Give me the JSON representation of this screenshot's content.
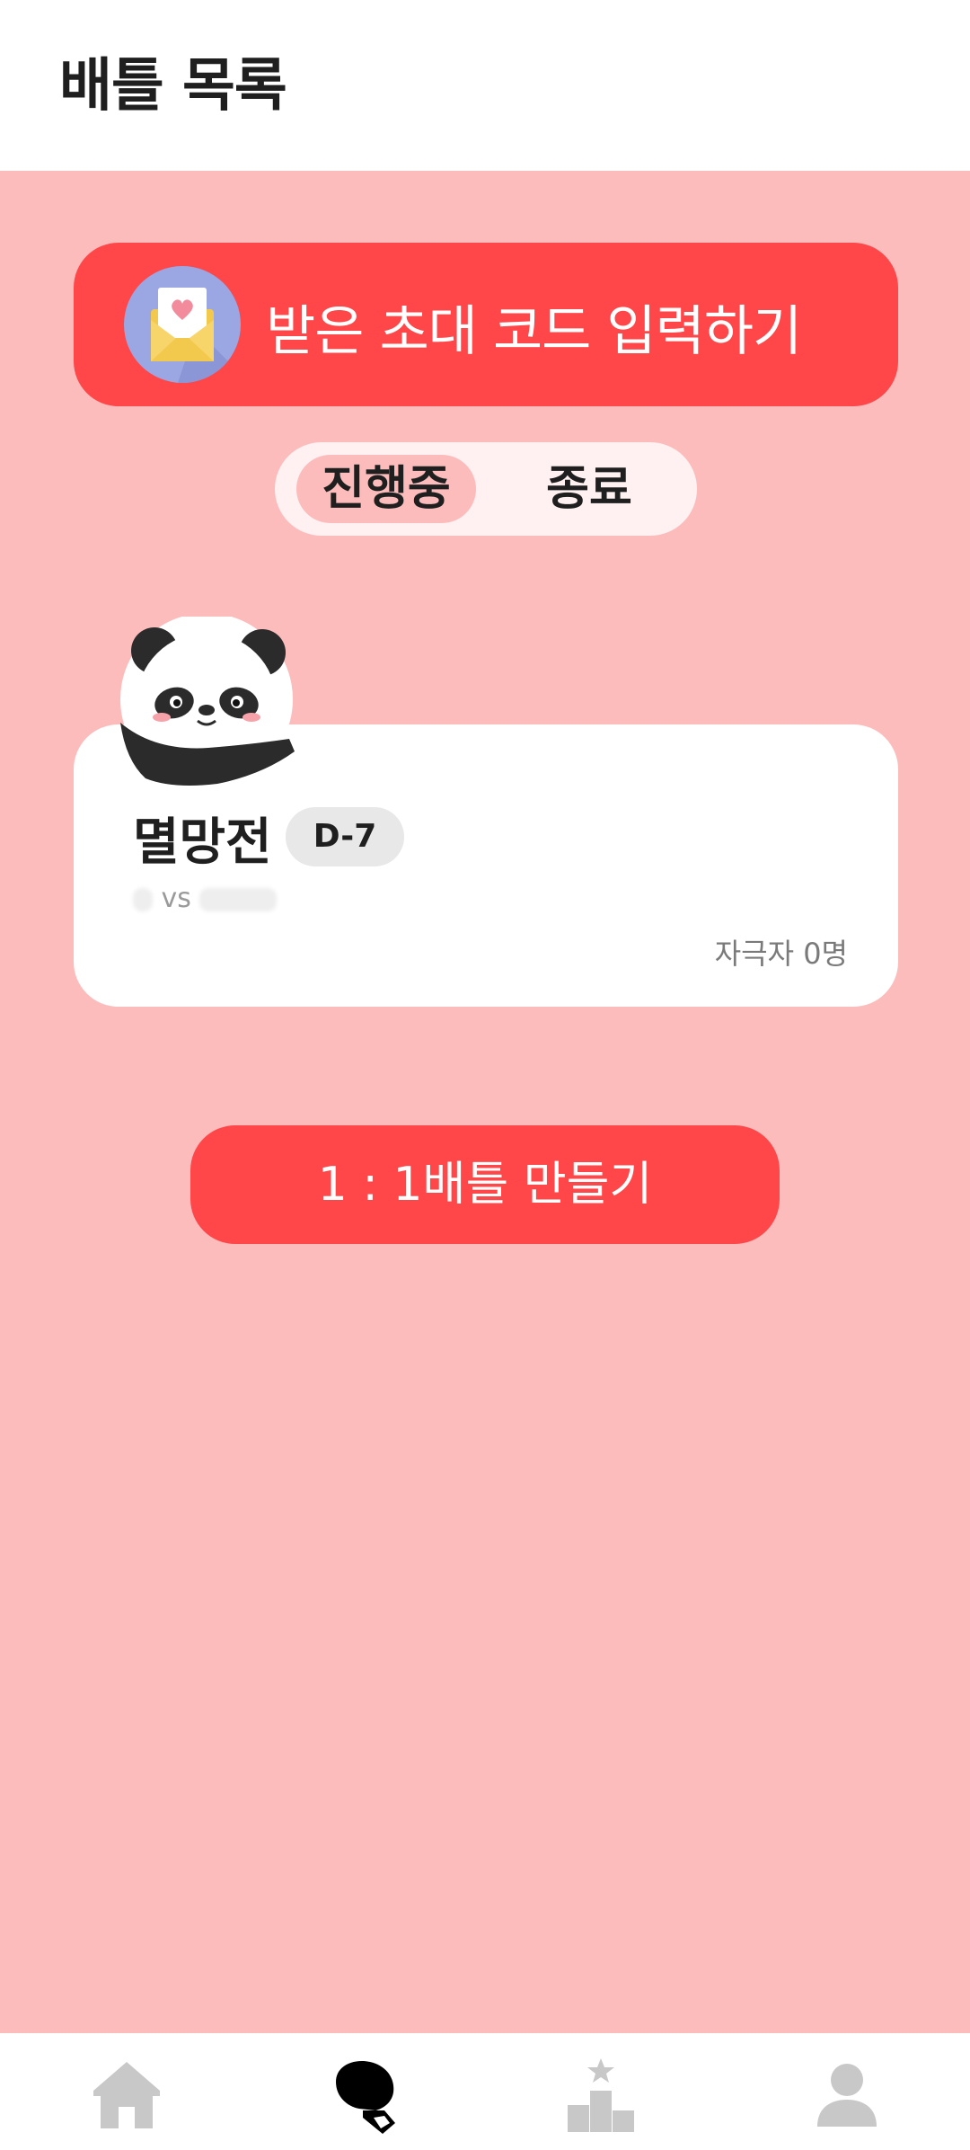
{
  "header": {
    "title": "배틀 목록"
  },
  "invite": {
    "label": "받은 초대 코드 입력하기",
    "icon": "envelope-heart-icon"
  },
  "tabs": [
    {
      "label": "진행중",
      "active": true
    },
    {
      "label": "종료",
      "active": false
    }
  ],
  "battles": [
    {
      "title": "멸망전",
      "dday": "D-7",
      "vs": "vs",
      "spectators": "자극자 0명",
      "avatar": "panda-icon"
    }
  ],
  "create_button": {
    "label": "1 : 1배틀 만들기"
  },
  "bottom_nav": [
    {
      "name": "home",
      "icon": "home-icon",
      "active": false
    },
    {
      "name": "battle",
      "icon": "boxing-glove-icon",
      "active": true
    },
    {
      "name": "ranking",
      "icon": "podium-icon",
      "active": false
    },
    {
      "name": "profile",
      "icon": "user-icon",
      "active": false
    }
  ],
  "colors": {
    "accent": "#ff4649",
    "background": "#fdbcbc",
    "nav_inactive": "#c8c8c8",
    "nav_active": "#000000"
  }
}
